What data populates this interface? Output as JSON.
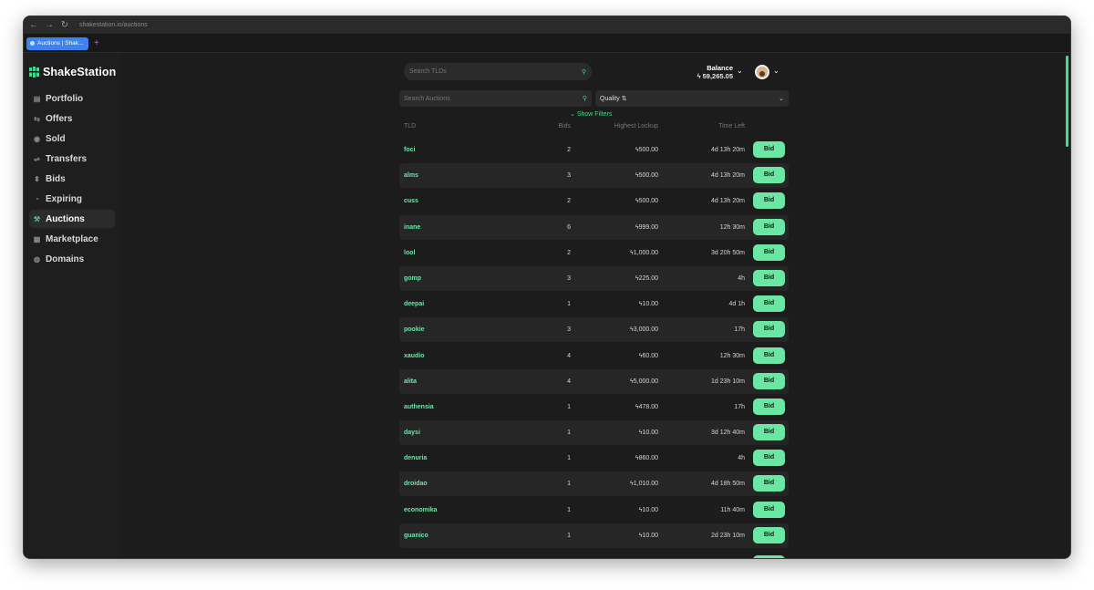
{
  "browser": {
    "url": "shakestation.io/auctions",
    "tab_title": "Auctions | Shak...",
    "new_tab": "+"
  },
  "sidebar": {
    "brand": "ShakeStation",
    "items": [
      {
        "label": "Portfolio",
        "icon": "portfolio-icon"
      },
      {
        "label": "Offers",
        "icon": "offers-icon"
      },
      {
        "label": "Sold",
        "icon": "sold-icon"
      },
      {
        "label": "Transfers",
        "icon": "transfers-icon"
      },
      {
        "label": "Bids",
        "icon": "bids-icon"
      },
      {
        "label": "Expiring",
        "icon": "expiring-icon"
      },
      {
        "label": "Auctions",
        "icon": "auctions-icon",
        "active": true
      },
      {
        "label": "Marketplace",
        "icon": "marketplace-icon"
      },
      {
        "label": "Domains",
        "icon": "domains-icon"
      }
    ]
  },
  "header": {
    "search_tlds_placeholder": "Search TLDs",
    "balance_label": "Balance",
    "balance_value": "59,265.05"
  },
  "filters": {
    "search_auctions_placeholder": "Search Auctions",
    "quality_label": "Quality",
    "show_filters": "Show Filters"
  },
  "table": {
    "columns": {
      "tld": "TLD",
      "bids": "Bids",
      "lockup": "Highest Lockup",
      "time": "Time Left"
    },
    "bid_label": "Bid",
    "rows": [
      {
        "tld": "foci",
        "bids": "2",
        "lockup": "500.00",
        "time": "4d 13h 20m"
      },
      {
        "tld": "alms",
        "bids": "3",
        "lockup": "500.00",
        "time": "4d 13h 20m"
      },
      {
        "tld": "cuss",
        "bids": "2",
        "lockup": "500.00",
        "time": "4d 13h 20m"
      },
      {
        "tld": "inane",
        "bids": "6",
        "lockup": "999.00",
        "time": "12h 30m"
      },
      {
        "tld": "lool",
        "bids": "2",
        "lockup": "1,000.00",
        "time": "3d 20h 50m"
      },
      {
        "tld": "gomp",
        "bids": "3",
        "lockup": "225.00",
        "time": "4h"
      },
      {
        "tld": "deepai",
        "bids": "1",
        "lockup": "10.00",
        "time": "4d 1h"
      },
      {
        "tld": "pookie",
        "bids": "3",
        "lockup": "3,000.00",
        "time": "17h"
      },
      {
        "tld": "xaudio",
        "bids": "4",
        "lockup": "60.00",
        "time": "12h 30m"
      },
      {
        "tld": "alita",
        "bids": "4",
        "lockup": "5,000.00",
        "time": "1d 23h 10m"
      },
      {
        "tld": "authensia",
        "bids": "1",
        "lockup": "478.00",
        "time": "17h"
      },
      {
        "tld": "daysi",
        "bids": "1",
        "lockup": "10.00",
        "time": "3d 12h 40m"
      },
      {
        "tld": "denuria",
        "bids": "1",
        "lockup": "860.00",
        "time": "4h"
      },
      {
        "tld": "droidao",
        "bids": "1",
        "lockup": "1,010.00",
        "time": "4d 18h 50m"
      },
      {
        "tld": "economika",
        "bids": "1",
        "lockup": "10.00",
        "time": "11h 40m"
      },
      {
        "tld": "guanico",
        "bids": "1",
        "lockup": "10.00",
        "time": "2d 23h 10m"
      }
    ]
  },
  "colors": {
    "accent": "#6be7a4",
    "brand_green": "#3ed58d",
    "background": "#1c1c1c"
  }
}
